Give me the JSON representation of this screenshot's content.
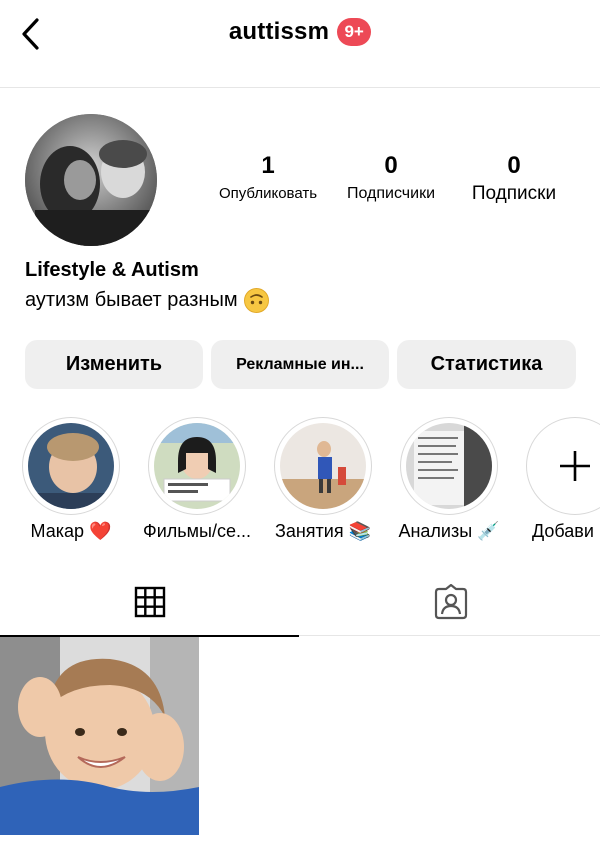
{
  "header": {
    "username": "auttissm",
    "badge": "9+"
  },
  "stats": [
    {
      "count": "1",
      "label": "Опубликовать"
    },
    {
      "count": "0",
      "label": "Подписчики"
    },
    {
      "count": "0",
      "label": "Подписки"
    }
  ],
  "profile": {
    "name": "Lifestyle & Autism",
    "bio": "аутизм бывает разным"
  },
  "buttons": {
    "edit": "Изменить",
    "ads": "Рекламные ин...",
    "stats": "Статистика"
  },
  "highlights": [
    {
      "label": "Макар ❤️"
    },
    {
      "label": "Фильмы/се..."
    },
    {
      "label": "Занятия 📚"
    },
    {
      "label": "Анализы 💉"
    },
    {
      "label": "Добави"
    }
  ],
  "tabs": [
    {
      "icon": "grid-icon"
    },
    {
      "icon": "tagged-icon"
    }
  ],
  "posts_count": 1
}
